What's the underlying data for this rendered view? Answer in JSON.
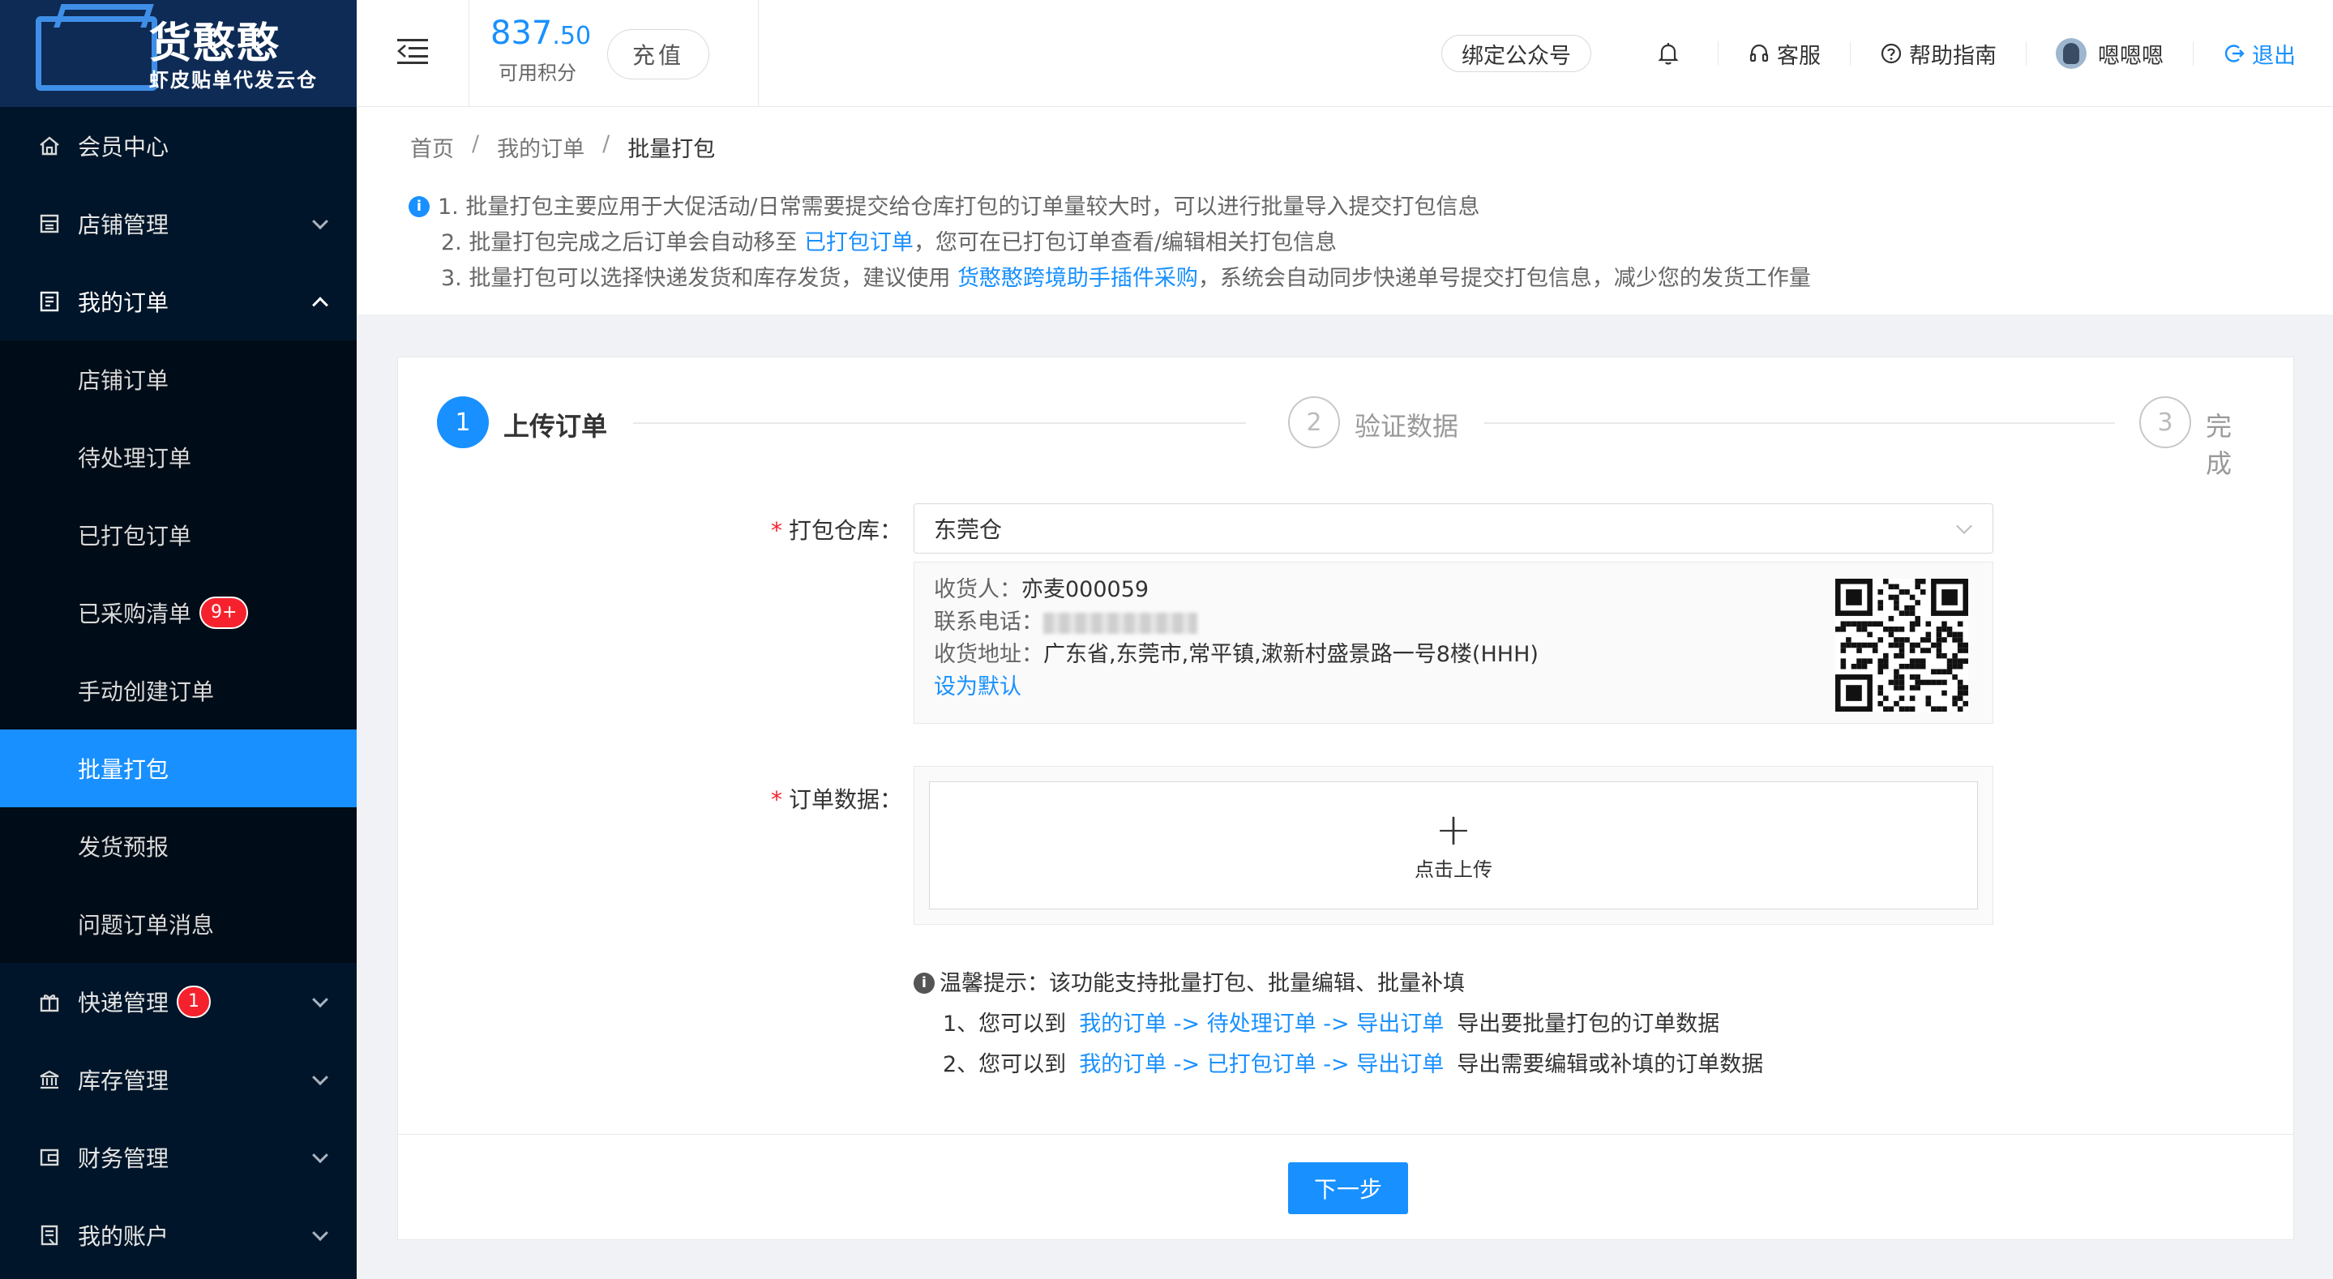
{
  "brand": {
    "title": "货憨憨",
    "subtitle": "虾皮贴单代发云仓"
  },
  "sidebar": {
    "items": [
      {
        "label": "会员中心",
        "icon": "home-icon"
      },
      {
        "label": "店铺管理",
        "icon": "shop-icon"
      },
      {
        "label": "我的订单",
        "icon": "order-icon"
      },
      {
        "label": "快递管理",
        "icon": "gift-icon",
        "badge": "1"
      },
      {
        "label": "库存管理",
        "icon": "bank-icon"
      },
      {
        "label": "财务管理",
        "icon": "wallet-icon"
      },
      {
        "label": "我的账户",
        "icon": "account-icon"
      }
    ],
    "submenu": [
      {
        "label": "店铺订单"
      },
      {
        "label": "待处理订单"
      },
      {
        "label": "已打包订单"
      },
      {
        "label": "已采购清单",
        "badge": "9+"
      },
      {
        "label": "手动创建订单"
      },
      {
        "label": "批量打包",
        "active": true
      },
      {
        "label": "发货预报"
      },
      {
        "label": "问题订单消息"
      }
    ]
  },
  "header": {
    "points_int": "837",
    "points_dec": ".50",
    "points_label": "可用积分",
    "recharge": "充值",
    "bind": "绑定公众号",
    "service": "客服",
    "help": "帮助指南",
    "user": "嗯嗯嗯",
    "logout": "退出"
  },
  "breadcrumb": [
    "首页",
    "我的订单",
    "批量打包"
  ],
  "notes": {
    "n1": "1. 批量打包主要应用于大促活动/日常需要提交给仓库打包的订单量较大时，可以进行批量导入提交打包信息",
    "n2a": "2. 批量打包完成之后订单会自动移至 ",
    "n2link": "已打包订单",
    "n2b": "，您可在已打包订单查看/编辑相关打包信息",
    "n3a": "3. 批量打包可以选择快递发货和库存发货，建议使用 ",
    "n3link": "货憨憨跨境助手插件采购",
    "n3b": "，系统会自动同步快递单号提交打包信息，减少您的发货工作量"
  },
  "steps": [
    {
      "num": "1",
      "title": "上传订单",
      "state": "active"
    },
    {
      "num": "2",
      "title": "验证数据",
      "state": "wait"
    },
    {
      "num": "3",
      "title": "完成",
      "state": "wait"
    }
  ],
  "form": {
    "warehouse_label": "打包仓库：",
    "warehouse_value": "东莞仓",
    "receiver_label": "收货人：",
    "receiver_value": "亦麦000059",
    "phone_label": "联系电话：",
    "address_label": "收货地址：",
    "address_value": "广东省,东莞市,常平镇,漱新村盛景路一号8楼(HHH)",
    "set_default": "设为默认",
    "order_data_label": "订单数据：",
    "upload_text": "点击上传"
  },
  "tips": {
    "title": "温馨提示：该功能支持批量打包、批量编辑、批量补填",
    "t1a": "1、您可以到",
    "t1link": "我的订单 -> 待处理订单 -> 导出订单",
    "t1b": "导出要批量打包的订单数据",
    "t2a": "2、您可以到",
    "t2link": "我的订单 -> 已打包订单 -> 导出订单",
    "t2b": "导出需要编辑或补填的订单数据"
  },
  "next_button": "下一步",
  "colors": {
    "primary": "#1890ff",
    "sidebar": "#001529",
    "danger": "#f5222d"
  }
}
